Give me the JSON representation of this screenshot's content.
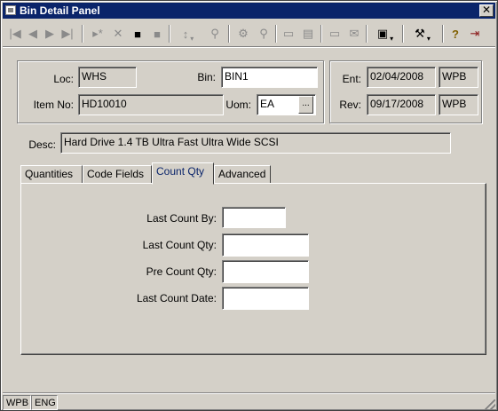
{
  "window": {
    "title": "Bin Detail Panel",
    "close_label": "✕"
  },
  "toolbar": {
    "first_icon": "|◀",
    "prev_icon": "◀",
    "next_icon": "▶",
    "last_icon": "▶|",
    "new_icon": "▸*",
    "delete_icon": "✕",
    "save_icon": "■",
    "cancel_icon": "■",
    "sort_icon": "↕",
    "find_icon": "⚲",
    "filter_icon": "⚙",
    "zoom_icon": "⚲",
    "form_icon": "▭",
    "doc_icon": "▤",
    "print_icon": "▭",
    "mail_icon": "✉",
    "print_preview_icon": "▣",
    "tools_icon": "⚒",
    "help_icon": "?",
    "exit_icon": "⇥",
    "dropdown_glyph": "▾"
  },
  "header": {
    "loc_label": "Loc:",
    "loc_value": "WHS",
    "bin_label": "Bin:",
    "bin_value": "BIN1",
    "item_label": "Item No:",
    "item_value": "HD10010",
    "uom_label": "Uom:",
    "uom_value": "EA",
    "uom_lookup": "...",
    "ent_label": "Ent:",
    "ent_date": "02/04/2008",
    "ent_user": "WPB",
    "rev_label": "Rev:",
    "rev_date": "09/17/2008",
    "rev_user": "WPB",
    "desc_label": "Desc:",
    "desc_value": "Hard Drive 1.4 TB Ultra Fast Ultra Wide SCSI"
  },
  "tabs": [
    {
      "label": "Quantities"
    },
    {
      "label": "Code Fields"
    },
    {
      "label": "Count Qty",
      "active": true
    },
    {
      "label": "Advanced"
    }
  ],
  "count_qty": {
    "last_count_by_label": "Last Count By:",
    "last_count_by_value": "",
    "last_count_qty_label": "Last Count Qty:",
    "last_count_qty_value": "",
    "pre_count_qty_label": "Pre Count Qty:",
    "pre_count_qty_value": "",
    "last_count_date_label": "Last Count Date:",
    "last_count_date_value": ""
  },
  "status": {
    "user": "WPB",
    "language": "ENG"
  }
}
